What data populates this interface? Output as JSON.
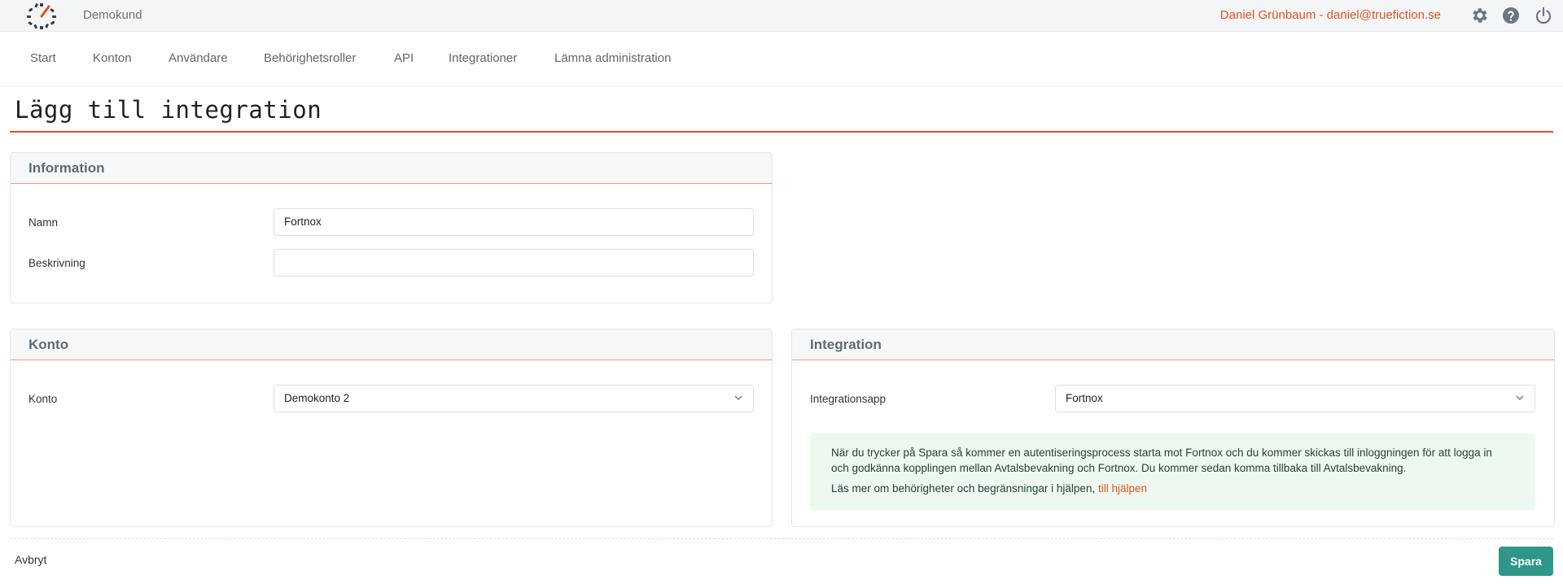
{
  "header": {
    "company": "Demokund",
    "user": "Daniel Grünbaum - daniel@truefiction.se",
    "icons": [
      "logo-icon",
      "gear-icon",
      "help-icon",
      "power-icon"
    ],
    "accent": "#e0531f"
  },
  "nav": {
    "items": [
      "Start",
      "Konton",
      "Användare",
      "Behörighetsroller",
      "API",
      "Integrationer",
      "Lämna administration"
    ]
  },
  "page": {
    "title": "Lägg till integration"
  },
  "information": {
    "title": "Information",
    "name_label": "Namn",
    "name_value": "Fortnox",
    "description_label": "Beskrivning",
    "description_value": ""
  },
  "konto": {
    "title": "Konto",
    "account_label": "Konto",
    "account_value": "Demokonto 2"
  },
  "integration": {
    "title": "Integration",
    "app_label": "Integrationsapp",
    "app_value": "Fortnox",
    "info_line1": "När du trycker på Spara så kommer en autentiseringsprocess starta mot Fortnox och du kommer skickas till inloggningen för att logga in",
    "info_line2": "och godkänna kopplingen mellan Avtalsbevakning och Fortnox. Du kommer sedan komma tillbaka till Avtalsbevakning.",
    "info_line3": "Läs mer om behörigheter och begränsningar i hjälpen,",
    "help_link": "till hjälpen",
    "info_bg": "#edf8f1"
  },
  "footer": {
    "cancel": "Avbryt",
    "save": "Spara",
    "save_color": "#2e978a"
  }
}
